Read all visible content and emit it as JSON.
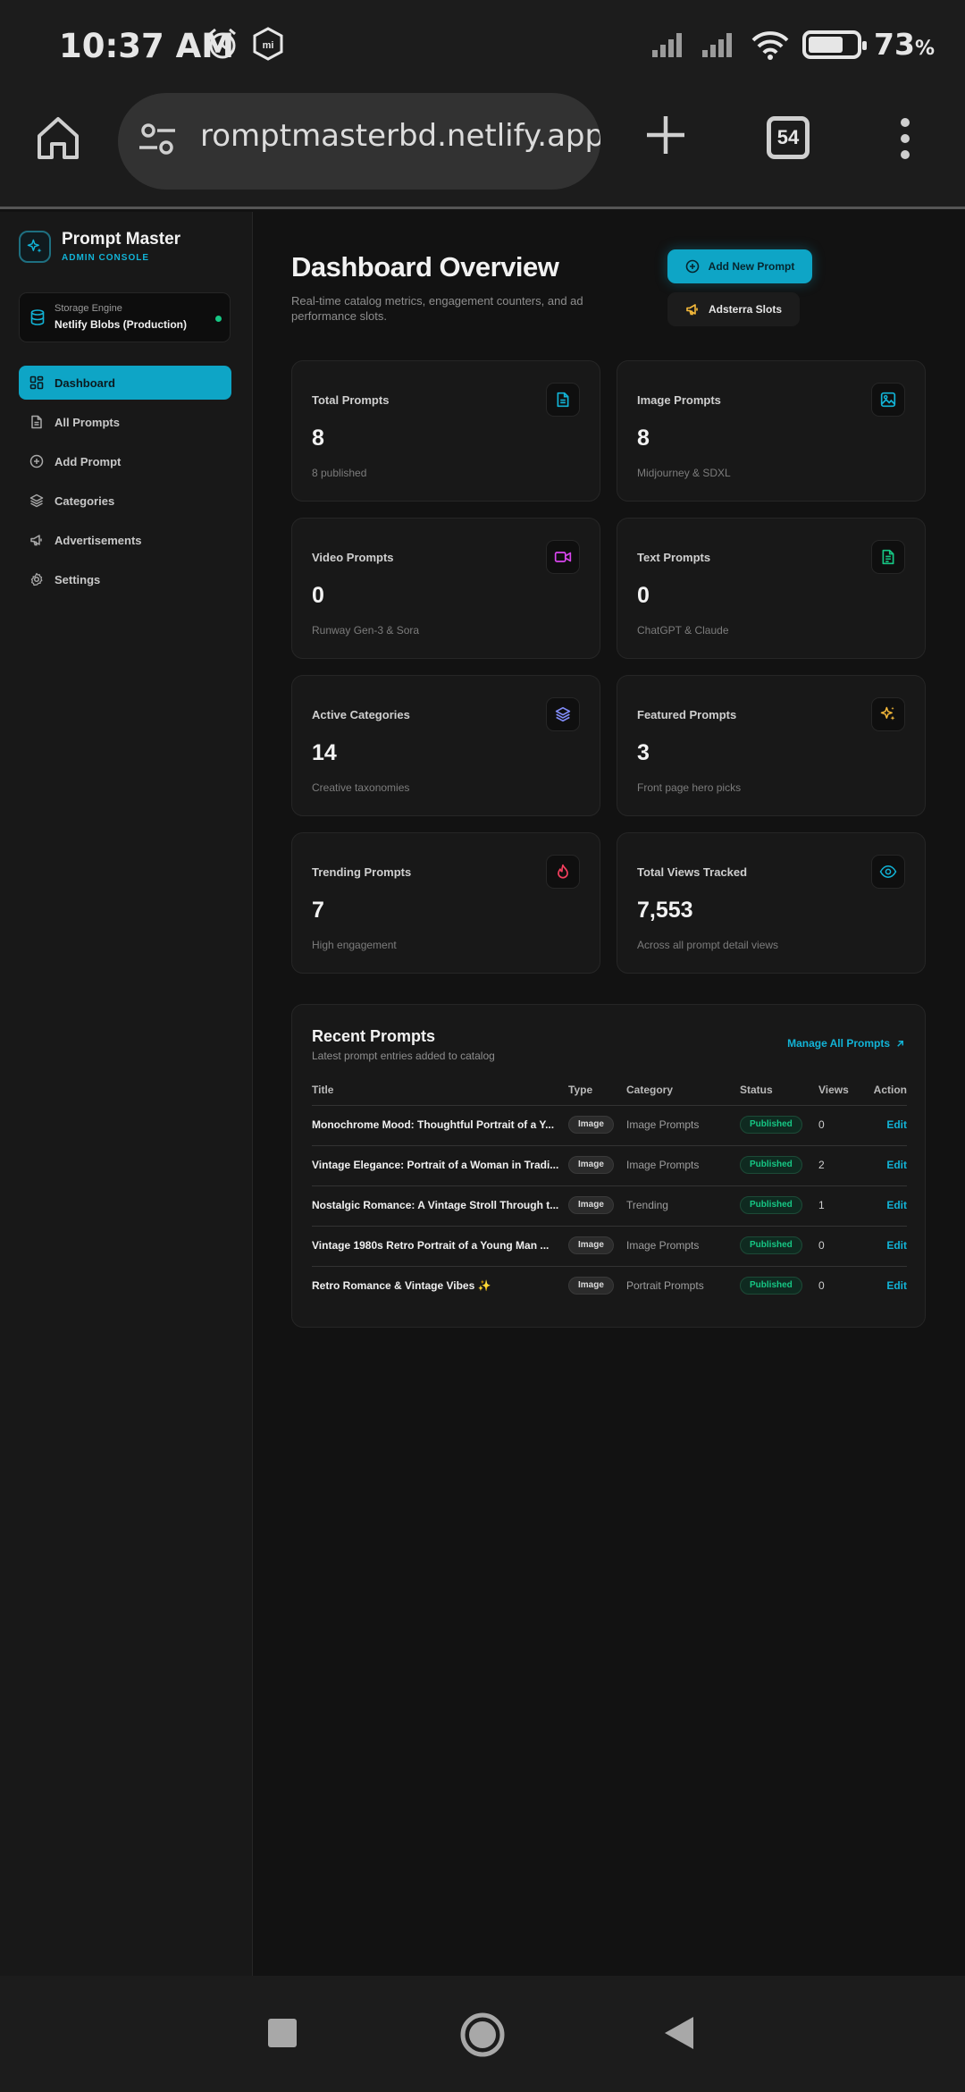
{
  "status_bar": {
    "time": "10:37 AM",
    "battery_pct": "73",
    "battery_unit": "%",
    "battery_level": 0.73
  },
  "browser": {
    "url": "romptmasterbd.netlify.app",
    "tab_count": "54"
  },
  "sidebar": {
    "brand_title": "Prompt Master",
    "brand_sub": "ADMIN CONSOLE",
    "storage_label": "Storage Engine",
    "storage_value": "Netlify Blobs (Production)",
    "items": [
      {
        "label": "Dashboard",
        "icon": "dashboard-icon",
        "active": true
      },
      {
        "label": "All Prompts",
        "icon": "document-icon"
      },
      {
        "label": "Add Prompt",
        "icon": "plus-circle-icon"
      },
      {
        "label": "Categories",
        "icon": "layers-icon"
      },
      {
        "label": "Advertisements",
        "icon": "megaphone-icon"
      },
      {
        "label": "Settings",
        "icon": "gear-icon"
      }
    ]
  },
  "header": {
    "title": "Dashboard Overview",
    "description": "Real-time catalog metrics, engagement counters, and ad performance slots.",
    "add_button": "Add New Prompt",
    "ads_button": "Adsterra Slots"
  },
  "stats": [
    {
      "label": "Total Prompts",
      "value": "8",
      "sub": "8 published",
      "icon": "document-icon",
      "color": "#12b3d6"
    },
    {
      "label": "Image Prompts",
      "value": "8",
      "sub": "Midjourney & SDXL",
      "icon": "image-icon",
      "color": "#12b3d6"
    },
    {
      "label": "Video Prompts",
      "value": "0",
      "sub": "Runway Gen-3 & Sora",
      "icon": "video-icon",
      "color": "#d946ef"
    },
    {
      "label": "Text Prompts",
      "value": "0",
      "sub": "ChatGPT & Claude",
      "icon": "text-doc-icon",
      "color": "#16c784"
    },
    {
      "label": "Active Categories",
      "value": "14",
      "sub": "Creative taxonomies",
      "icon": "layers-icon",
      "color": "#818cf8"
    },
    {
      "label": "Featured Prompts",
      "value": "3",
      "sub": "Front page hero picks",
      "icon": "sparkles-icon",
      "color": "#f5b93a"
    },
    {
      "label": "Trending Prompts",
      "value": "7",
      "sub": "High engagement",
      "icon": "flame-icon",
      "color": "#f43f5e"
    },
    {
      "label": "Total Views Tracked",
      "value": "7,553",
      "sub": "Across all prompt detail views",
      "icon": "eye-icon",
      "color": "#12b3d6"
    }
  ],
  "recent": {
    "title": "Recent Prompts",
    "subtitle": "Latest prompt entries added to catalog",
    "manage_link": "Manage All Prompts",
    "columns": {
      "title": "Title",
      "type": "Type",
      "category": "Category",
      "status": "Status",
      "views": "Views",
      "action": "Action"
    },
    "rows": [
      {
        "title": "Monochrome Mood: Thoughtful Portrait of a Y...",
        "type": "Image",
        "category": "Image Prompts",
        "status": "Published",
        "views": "0",
        "action": "Edit"
      },
      {
        "title": "Vintage Elegance: Portrait of a Woman in Tradi...",
        "type": "Image",
        "category": "Image Prompts",
        "status": "Published",
        "views": "2",
        "action": "Edit"
      },
      {
        "title": "Nostalgic Romance: A Vintage Stroll Through t...",
        "type": "Image",
        "category": "Trending",
        "status": "Published",
        "views": "1",
        "action": "Edit"
      },
      {
        "title": "Vintage 1980s Retro Portrait of a Young Man ...",
        "type": "Image",
        "category": "Image Prompts",
        "status": "Published",
        "views": "0",
        "action": "Edit"
      },
      {
        "title": "Retro Romance & Vintage Vibes ✨",
        "type": "Image",
        "category": "Portrait Prompts",
        "status": "Published",
        "views": "0",
        "action": "Edit"
      }
    ]
  },
  "colors": {
    "accent": "#0ea5c6",
    "success": "#16c784",
    "background": "#121212",
    "surface": "#181818"
  }
}
